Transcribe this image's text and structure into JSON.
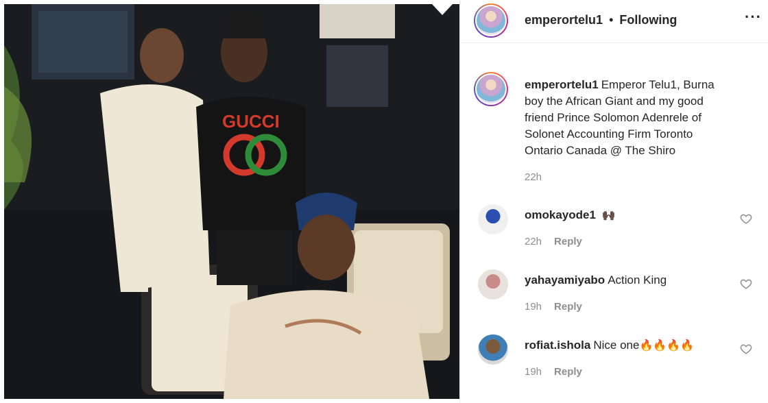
{
  "header": {
    "username": "emperortelu1",
    "separator": "•",
    "follow_status": "Following",
    "more_icon": "more-options-icon",
    "more_glyph": "···"
  },
  "caption": {
    "username": "emperortelu1",
    "text": "Emperor Telu1, Burna boy the African Giant and my good friend Prince Solomon Adenrele of Solonet Accounting Firm Toronto Ontario Canada @ The Shiro",
    "time": "22h"
  },
  "comments": [
    {
      "username": "omokayode1",
      "text": "",
      "emoji": "🙌🏿",
      "time": "22h",
      "reply_label": "Reply"
    },
    {
      "username": "yahayamiyabo",
      "text": "Action King",
      "emoji": "",
      "time": "19h",
      "reply_label": "Reply"
    },
    {
      "username": "rofiat.ishola",
      "text": "Nice one",
      "emoji": "🔥🔥🔥🔥",
      "time": "19h",
      "reply_label": "Reply"
    }
  ],
  "colors": {
    "text": "#262626",
    "muted": "#8e8e8e",
    "border": "#efefef"
  }
}
